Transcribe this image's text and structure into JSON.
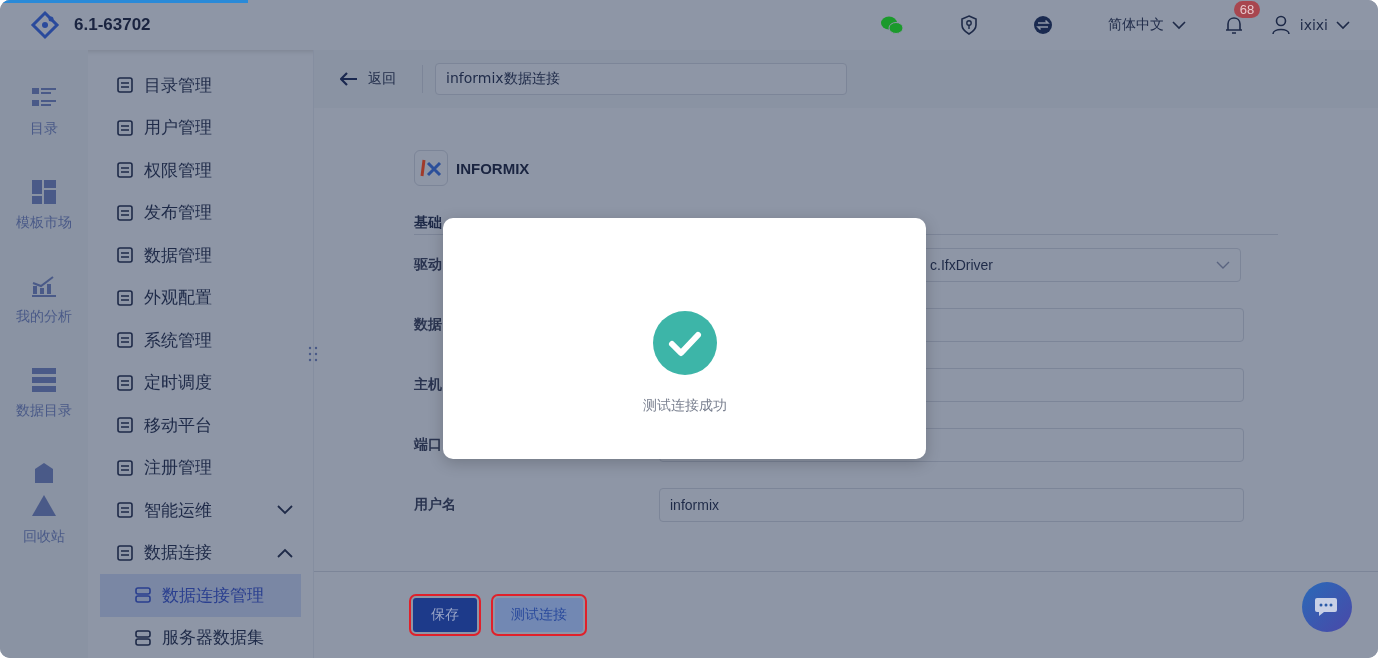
{
  "loading_bar": {
    "level": 0.18
  },
  "header": {
    "version": "6.1-63702",
    "language": "简体中文",
    "notifications": "68",
    "user": "ixixi"
  },
  "rail": [
    {
      "label": "目录"
    },
    {
      "label": "模板市场"
    },
    {
      "label": "我的分析"
    },
    {
      "label": "数据目录"
    },
    {
      "label": "回收站"
    }
  ],
  "menu": [
    {
      "label": "目录管理"
    },
    {
      "label": "用户管理"
    },
    {
      "label": "权限管理"
    },
    {
      "label": "发布管理"
    },
    {
      "label": "数据管理"
    },
    {
      "label": "外观配置"
    },
    {
      "label": "系统管理"
    },
    {
      "label": "定时调度"
    },
    {
      "label": "移动平台"
    },
    {
      "label": "注册管理"
    },
    {
      "label": "智能运维",
      "expanded": false
    },
    {
      "label": "数据连接",
      "expanded": true,
      "children": [
        {
          "label": "数据连接管理",
          "selected": true
        },
        {
          "label": "服务器数据集",
          "selected": false
        }
      ]
    }
  ],
  "topbar": {
    "back": "返回",
    "title": "informix数据连接"
  },
  "form": {
    "db_name": "INFORMIX",
    "section": "基础",
    "rows": [
      {
        "label": "驱动",
        "value": "c.IfxDriver",
        "kind": "select"
      },
      {
        "label": "数据",
        "kind": "input"
      },
      {
        "label": "主机",
        "kind": "input"
      },
      {
        "label": "端口",
        "kind": "input"
      },
      {
        "label": "用户名",
        "value": "informix",
        "kind": "input"
      }
    ]
  },
  "footer": {
    "buttons": [
      {
        "label": "保存",
        "kind": "primary",
        "highlighted": true
      },
      {
        "label": "测试连接",
        "kind": "secondary",
        "highlighted": true
      }
    ]
  },
  "dialog": {
    "message": "测试连接成功"
  }
}
